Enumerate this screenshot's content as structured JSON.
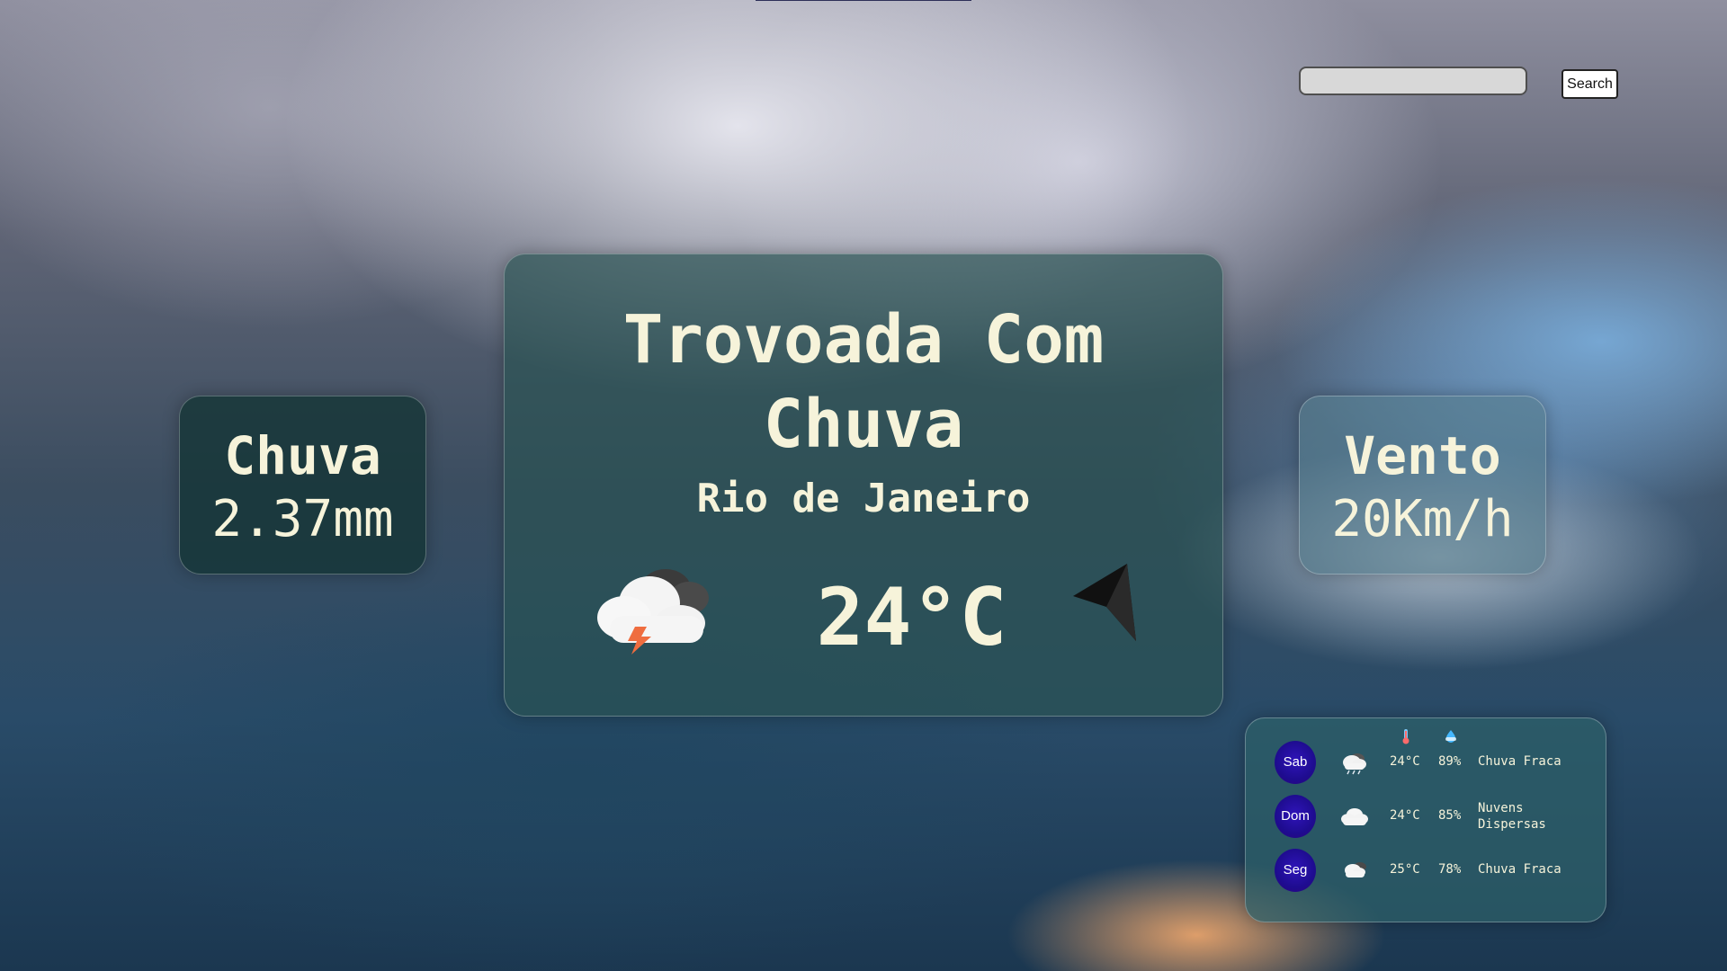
{
  "search": {
    "placeholder": "",
    "value": "",
    "button_label": "Search"
  },
  "current_weather": {
    "title": "Trovoada Com Chuva",
    "city": "Rio de Janeiro",
    "temperature": "24°C",
    "weather_icon": "thunderstorm-cloud-icon",
    "wind_direction_icon": "wind-direction-arrow-icon"
  },
  "rain": {
    "title": "Chuva",
    "value": "2.37mm"
  },
  "wind": {
    "title": "Vento",
    "value": "20Km/h"
  },
  "forecast": {
    "header_icons": [
      "thermometer-icon",
      "humidity-icon"
    ],
    "days": [
      {
        "day": "Sab",
        "icon": "light-rain-cloud-icon",
        "temperature": "24°C",
        "humidity": "89%",
        "description": "Chuva Fraca"
      },
      {
        "day": "Dom",
        "icon": "cloud-icon",
        "temperature": "24°C",
        "humidity": "85%",
        "description": "Nuvens Dispersas"
      },
      {
        "day": "Seg",
        "icon": "partly-cloudy-icon",
        "temperature": "25°C",
        "humidity": "78%",
        "description": "Chuva Fraca"
      }
    ]
  },
  "colors": {
    "text": "#f6f3da",
    "main_card": "#2a5252",
    "badge": "#1e0c8f"
  }
}
